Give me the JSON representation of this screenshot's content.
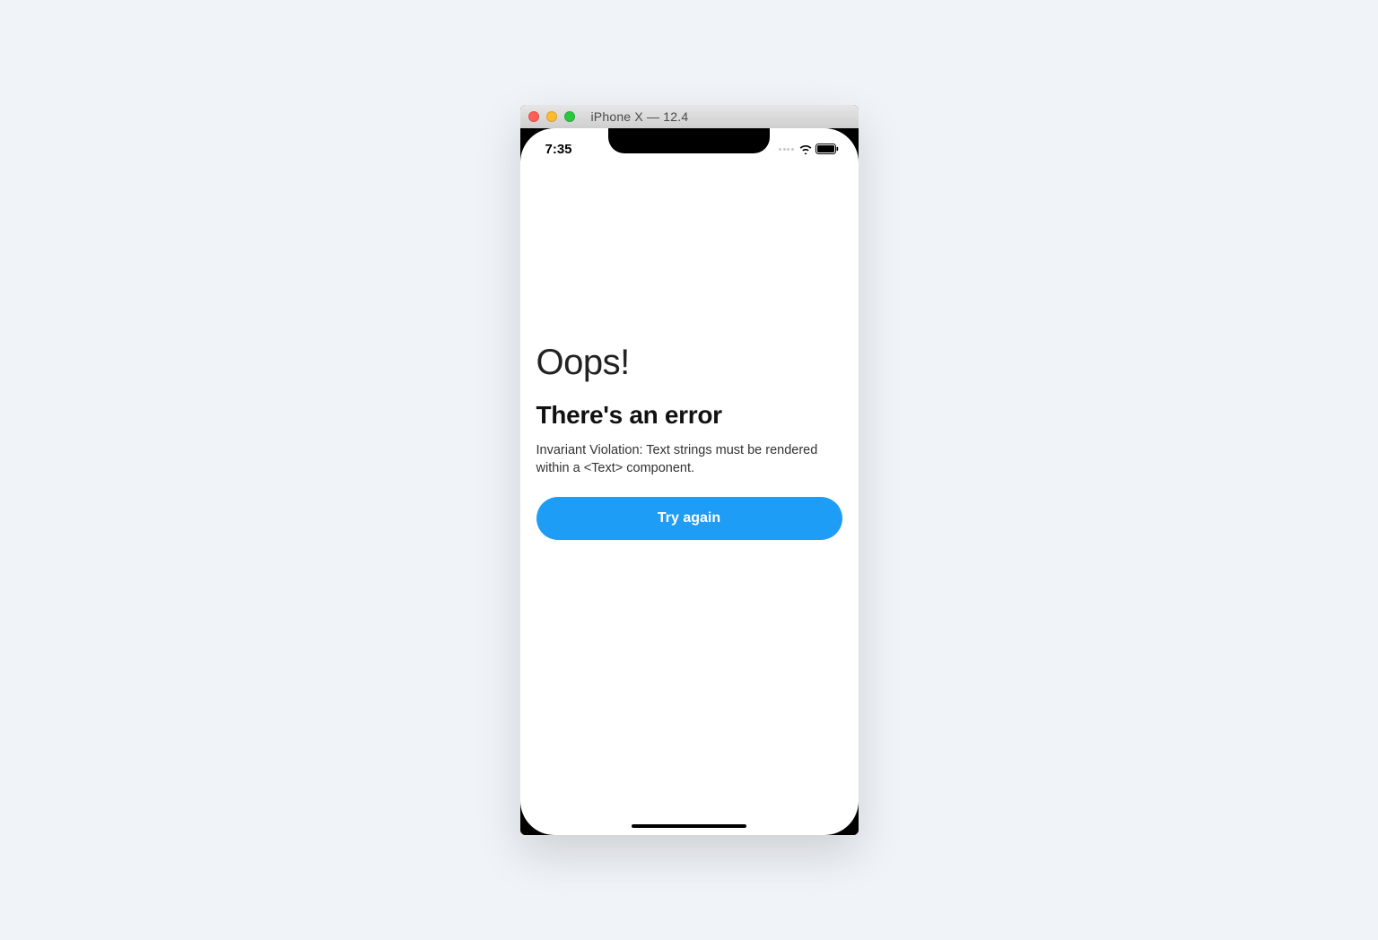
{
  "window": {
    "title": "iPhone X — 12.4"
  },
  "statusbar": {
    "time": "7:35"
  },
  "screen": {
    "heading": "Oops!",
    "subheading": "There's an error",
    "message": "Invariant Violation: Text strings must be rendered within a <Text> component.",
    "button_label": "Try again"
  },
  "colors": {
    "accent": "#1e9df7"
  }
}
